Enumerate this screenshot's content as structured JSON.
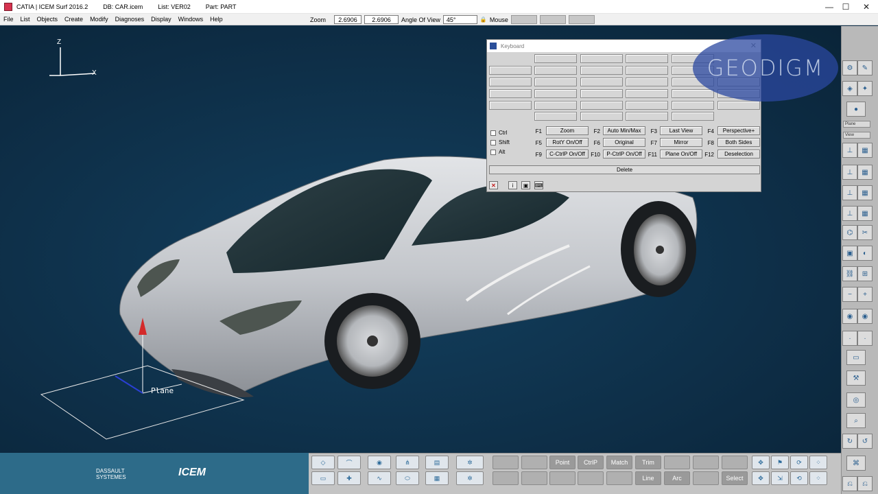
{
  "titlebar": {
    "app": "CATIA | ICEM Surf 2016.2",
    "db": "DB: CAR.icem",
    "list": "List: VER02",
    "part": "Part: PART",
    "minimize": "—",
    "maximize": "☐",
    "close": "✕"
  },
  "menu": {
    "items": [
      "File",
      "List",
      "Objects",
      "Create",
      "Modify",
      "Diagnoses",
      "Display",
      "Windows",
      "Help"
    ]
  },
  "zoom": {
    "label": "Zoom",
    "value1": "2.6906",
    "value2": "2.6906",
    "angle_label": "Angle Of View",
    "angle_value": "45°",
    "mouse_label": "Mouse"
  },
  "viewport": {
    "axis_z": "Z",
    "axis_x": "X",
    "plane_label": "Plane"
  },
  "keyboard_dialog": {
    "title": "Keyboard",
    "close": "✕",
    "modifiers": [
      "Ctrl",
      "Shift",
      "Alt"
    ],
    "fkeys": [
      {
        "key": "F1",
        "label": "Zoom"
      },
      {
        "key": "F2",
        "label": "Auto Min/Max"
      },
      {
        "key": "F3",
        "label": "Last View"
      },
      {
        "key": "F4",
        "label": "Perspective+"
      },
      {
        "key": "F5",
        "label": "RotY On/Off"
      },
      {
        "key": "F6",
        "label": "Original"
      },
      {
        "key": "F7",
        "label": "Mirror"
      },
      {
        "key": "F8",
        "label": "Both Sides"
      },
      {
        "key": "F9",
        "label": "C-CtrlP On/Off"
      },
      {
        "key": "F10",
        "label": "P-CtrlP On/Off"
      },
      {
        "key": "F11",
        "label": "Plane On/Off"
      },
      {
        "key": "F12",
        "label": "Deselection"
      }
    ],
    "delete_label": "Delete"
  },
  "watermark": "GEODIGM",
  "brand": {
    "dassault": "DASSAULT SYSTEMES",
    "icem": "ICEM"
  },
  "bottom_buttons": {
    "point": "Point",
    "ctrlp": "CtrlP",
    "match": "Match",
    "trim": "Trim",
    "line": "Line",
    "arc": "Arc",
    "select": "Select"
  },
  "right_toolbar": {
    "select1": "Plane",
    "select2": "View"
  },
  "colors": {
    "viewport": "#0f3049",
    "bottom_brand": "#2d6b89",
    "toolbar": "#c4c4c4"
  }
}
